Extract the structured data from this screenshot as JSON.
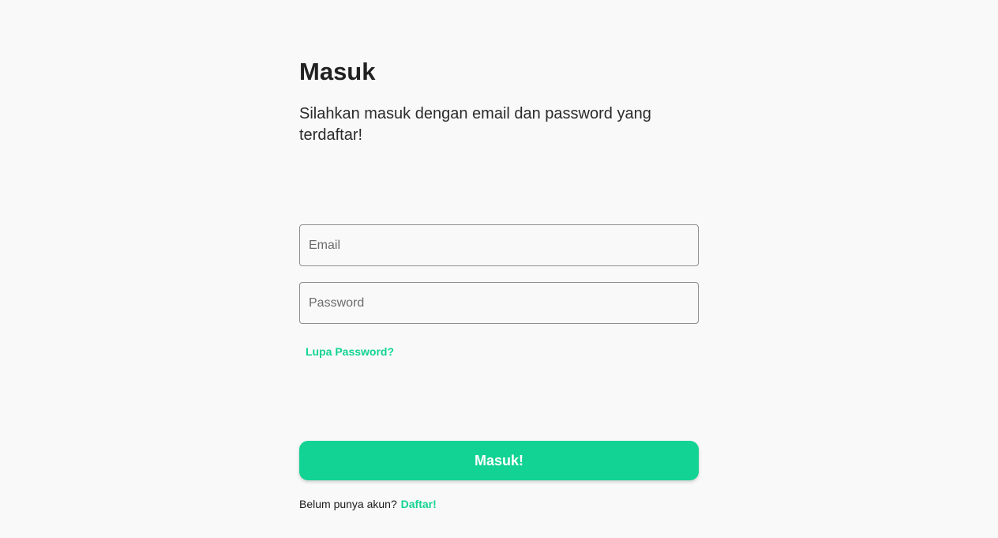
{
  "login": {
    "title": "Masuk",
    "subtitle": "Silahkan masuk dengan email dan password yang terdaftar!",
    "email_placeholder": "Email",
    "email_value": "",
    "password_placeholder": "Password",
    "password_value": "",
    "forgot_password": "Lupa Password?",
    "submit_label": "Masuk!",
    "register_prompt": "Belum punya akun?",
    "register_link": "Daftar!"
  },
  "colors": {
    "accent": "#12d393",
    "background": "#f9f9f9",
    "text": "#212121",
    "field_border": "#8e8e8e"
  }
}
